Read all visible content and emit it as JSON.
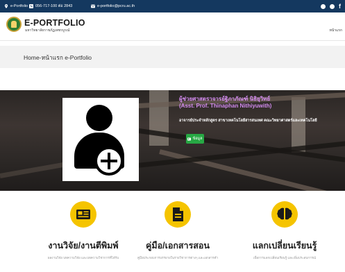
{
  "topbar": {
    "site_label": "e-Portfolio",
    "phone": "056-717-100 ต่อ 2843",
    "email": "e-portfolio@pcru.ac.th"
  },
  "header": {
    "logo_title": "E-PORTFOLIO",
    "logo_subtitle": "มหาวิทยาลัยราชภัฏเพชรบูรณ์",
    "menu_home": "หน้าแรก"
  },
  "breadcrumb": "Home-หน้าแรก e-Portfolio",
  "profile": {
    "name_th": "ผู้ช่วยศาสตราจารย์ฐิภาภัณฑ์ นิธิยุวิทย์",
    "name_en": "(Asst. Prof. Thinaphan Nithiyuwith)",
    "position": "อาจารย์ประจำหลักสูตร สาขาเทคโนโลยีสารสนเทศ คณะวิทยาศาสตร์และเทคโนโลยี",
    "data_button": "ข้อมูล"
  },
  "features": [
    {
      "title": "งานวิจัย/งานตีพิมพ์",
      "desc": "ผลงานวิจัย บทความวิจัย และบทความวิชาการที่ได้รับ",
      "icon": "newspaper-icon"
    },
    {
      "title": "คู่มือ/เอกสารสอน",
      "desc": "คู่มือประกอบการบรรยายในรายวิชาการต่างๆ และเอกสารคำ",
      "icon": "document-icon"
    },
    {
      "title": "แลกเปลี่ยนเรียนรู้",
      "desc": "เพื่อการแลกเปลี่ยนเรียนรู้ และเพิ่มประสบการณ์",
      "icon": "brain-icon"
    }
  ],
  "colors": {
    "topbar": "#14385f",
    "accent_yellow": "#f5c400",
    "button_green": "#27a844",
    "name_purple": "#d48cf0"
  }
}
